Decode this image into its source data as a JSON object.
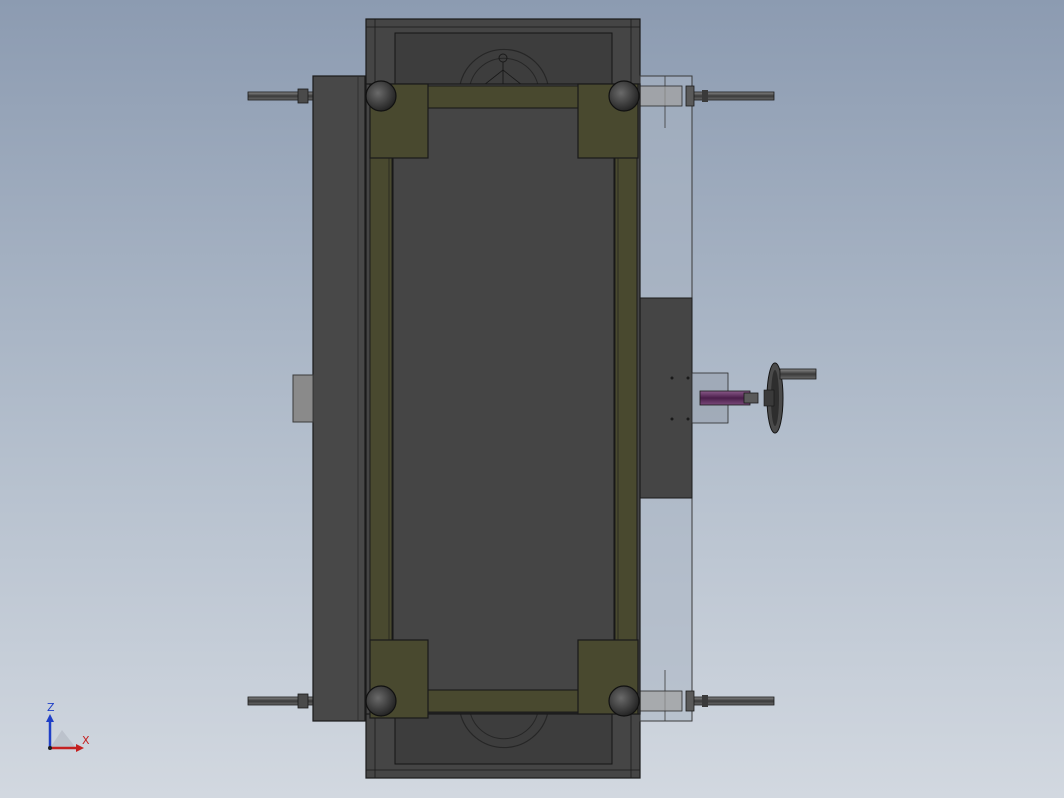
{
  "viewport": {
    "background_top": "#8c9bb1",
    "background_bottom": "#d2d8e0"
  },
  "model": {
    "body_color": "#454545",
    "frame_color": "#49492f",
    "accent_color": "#6a3a6a"
  },
  "triad": {
    "z_label": "Z",
    "x_label": "X",
    "z_color": "#1f3fc7",
    "x_color": "#c42020"
  }
}
